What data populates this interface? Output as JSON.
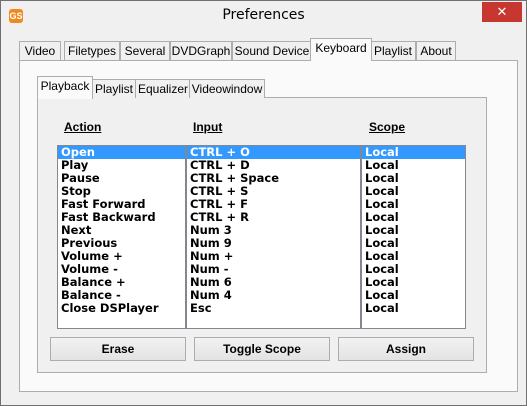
{
  "window": {
    "title": "Preferences",
    "icon": "app-logo-icon",
    "close_glyph": "✕"
  },
  "top_tabs": [
    "Video",
    "Filetypes",
    "Several",
    "DVDGraph",
    "Sound Device",
    "Keyboard",
    "Playlist",
    "About"
  ],
  "top_tab_selected": "Keyboard",
  "inner_tabs": [
    "Playback",
    "Playlist",
    "Equalizer",
    "Videowindow"
  ],
  "inner_tab_selected": "Playback",
  "columns": {
    "action": "Action",
    "input": "Input",
    "scope": "Scope"
  },
  "bindings": [
    {
      "action": "Open",
      "input": "CTRL + O",
      "scope": "Local"
    },
    {
      "action": "Play",
      "input": "CTRL + D",
      "scope": "Local"
    },
    {
      "action": "Pause",
      "input": "CTRL + Space",
      "scope": "Local"
    },
    {
      "action": "Stop",
      "input": "CTRL + S",
      "scope": "Local"
    },
    {
      "action": "Fast Forward",
      "input": "CTRL + F",
      "scope": "Local"
    },
    {
      "action": "Fast Backward",
      "input": "CTRL + R",
      "scope": "Local"
    },
    {
      "action": "Next",
      "input": "Num 3",
      "scope": "Local"
    },
    {
      "action": "Previous",
      "input": "Num 9",
      "scope": "Local"
    },
    {
      "action": "Volume +",
      "input": "Num +",
      "scope": "Local"
    },
    {
      "action": "Volume -",
      "input": "Num -",
      "scope": "Local"
    },
    {
      "action": "Balance +",
      "input": "Num 6",
      "scope": "Local"
    },
    {
      "action": "Balance -",
      "input": "Num 4",
      "scope": "Local"
    },
    {
      "action": "Close DSPlayer",
      "input": "Esc",
      "scope": "Local"
    }
  ],
  "selected_row": 0,
  "buttons": {
    "erase": "Erase",
    "toggle_scope": "Toggle Scope",
    "assign": "Assign"
  },
  "colors": {
    "selection": "#3399ff",
    "close_button": "#c7372f"
  }
}
